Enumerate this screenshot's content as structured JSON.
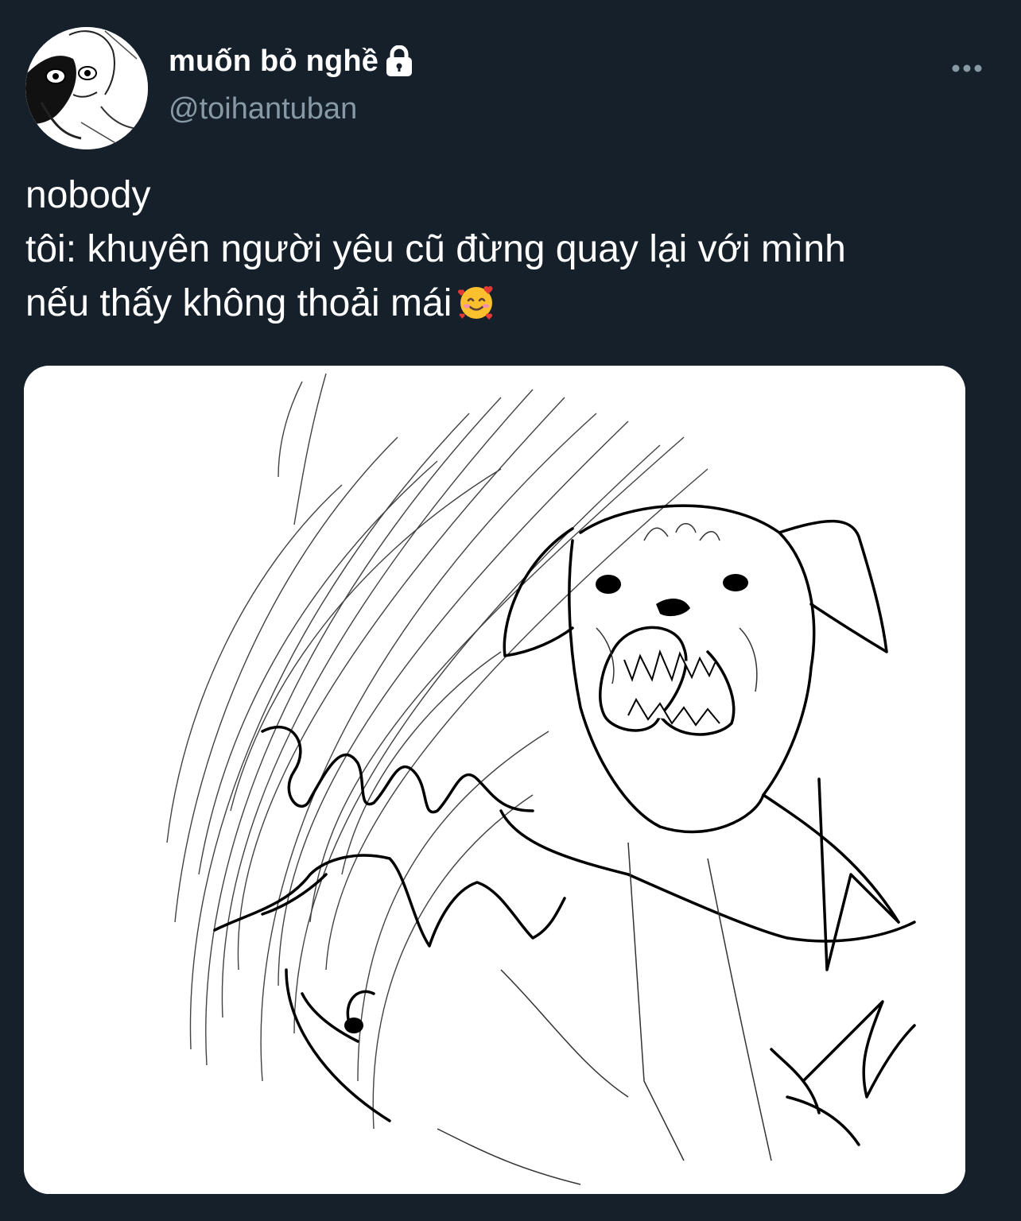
{
  "tweet": {
    "author": {
      "display_name": "muốn bỏ nghề",
      "handle": "@toihantuban",
      "protected_icon": "lock-icon",
      "avatar_icon": "avatar-sketch"
    },
    "more_icon": "more-dots-icon",
    "text_lines": [
      "nobody",
      "tôi: khuyên người yêu cũ đừng quay lại với mình",
      "nếu thấy không thoải mái"
    ],
    "emoji": "🥰",
    "emoji_name": "smiling-face-with-hearts-emoji",
    "media": {
      "type": "image",
      "description_icon": "angry-dog-sketch-image"
    }
  },
  "colors": {
    "background": "#15202b",
    "text_primary": "#ffffff",
    "text_secondary": "#8899a6",
    "media_background": "#ffffff"
  }
}
